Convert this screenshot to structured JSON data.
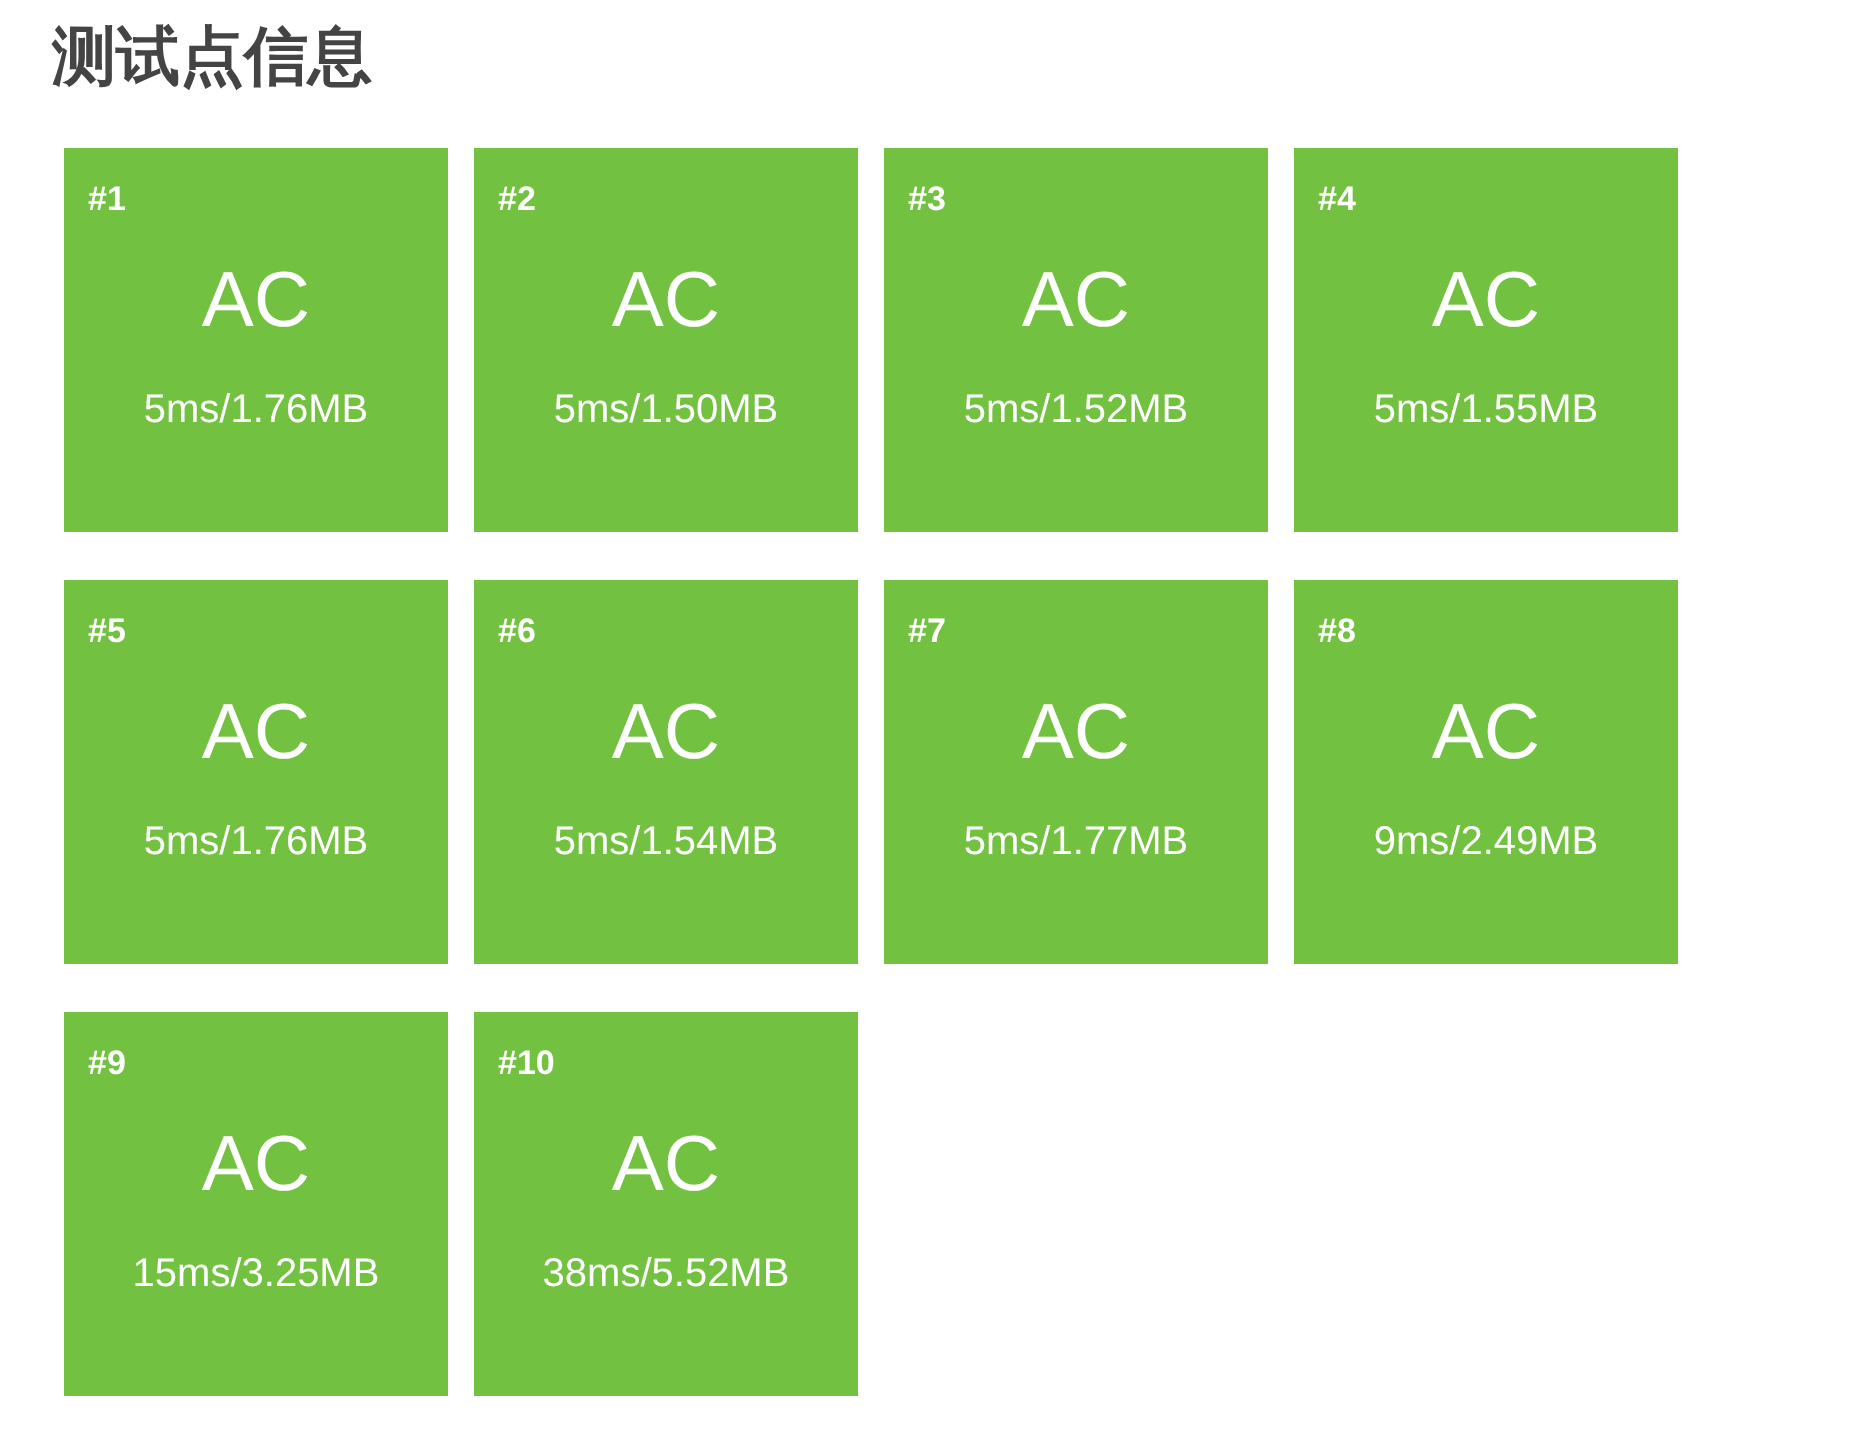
{
  "title": "测试点信息",
  "test_cases": [
    {
      "number": "#1",
      "verdict": "AC",
      "usage": "5ms/1.76MB",
      "color": "#72c140"
    },
    {
      "number": "#2",
      "verdict": "AC",
      "usage": "5ms/1.50MB",
      "color": "#72c140"
    },
    {
      "number": "#3",
      "verdict": "AC",
      "usage": "5ms/1.52MB",
      "color": "#72c140"
    },
    {
      "number": "#4",
      "verdict": "AC",
      "usage": "5ms/1.55MB",
      "color": "#72c140"
    },
    {
      "number": "#5",
      "verdict": "AC",
      "usage": "5ms/1.76MB",
      "color": "#72c140"
    },
    {
      "number": "#6",
      "verdict": "AC",
      "usage": "5ms/1.54MB",
      "color": "#72c140"
    },
    {
      "number": "#7",
      "verdict": "AC",
      "usage": "5ms/1.77MB",
      "color": "#72c140"
    },
    {
      "number": "#8",
      "verdict": "AC",
      "usage": "9ms/2.49MB",
      "color": "#72c140"
    },
    {
      "number": "#9",
      "verdict": "AC",
      "usage": "15ms/3.25MB",
      "color": "#72c140"
    },
    {
      "number": "#10",
      "verdict": "AC",
      "usage": "38ms/5.52MB",
      "color": "#72c140"
    }
  ]
}
